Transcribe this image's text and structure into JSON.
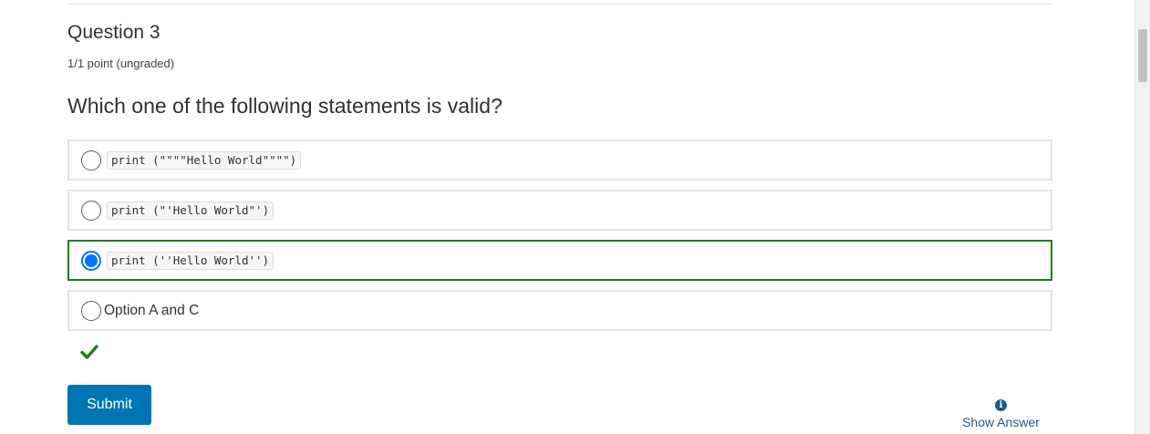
{
  "question": {
    "title": "Question 3",
    "points": "1/1 point (ungraded)",
    "prompt": "Which one of the following statements is valid?"
  },
  "choices": [
    {
      "code": "print (\"\"\"\"Hello World\"\"\"\")",
      "text": "",
      "selected": false
    },
    {
      "code": "print (\"'Hello World\"')",
      "text": "",
      "selected": false
    },
    {
      "code": "print (''Hello World'')",
      "text": "",
      "selected": true
    },
    {
      "code": "",
      "text": "Option A and C",
      "selected": false
    }
  ],
  "status": {
    "correct_icon": "checkmark-icon",
    "correct_color": "#1e7e1e"
  },
  "actions": {
    "submit_label": "Submit",
    "show_answer_label": "Show Answer",
    "show_answer_icon": "info-icon"
  },
  "colors": {
    "submit_bg": "#0075b4",
    "selected_border": "#1e7e1e",
    "radio_checked": "#0075ff",
    "link": "#1e5a8c"
  }
}
